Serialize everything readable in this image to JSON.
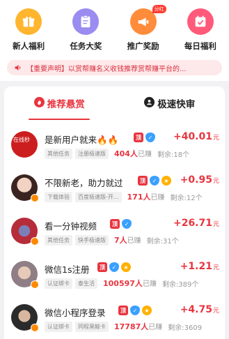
{
  "quick_actions": [
    {
      "label": "新人福利",
      "icon": "gift-icon",
      "color": "#ffb52e"
    },
    {
      "label": "任务大奖",
      "icon": "clipboard-icon",
      "color": "#9a8cf0"
    },
    {
      "label": "推广奖励",
      "icon": "megaphone-icon",
      "color": "#ff8c3a",
      "badge": "分红"
    },
    {
      "label": "每日福利",
      "icon": "calendar-check-icon",
      "color": "#ff5a7a"
    }
  ],
  "notice": {
    "text": "【重要声明】以赏帮赚名义收钱推荐赏帮赚平台的..."
  },
  "tabs": [
    {
      "label": "推荐悬赏",
      "active": true
    },
    {
      "label": "极速快审",
      "active": false
    }
  ],
  "tasks": [
    {
      "title": "是新用户就来🔥🔥",
      "tags": [
        "其他任务",
        "注册极速版"
      ],
      "earned_count": "404人",
      "earned_suffix": "已赚",
      "remaining": "剩余:18个",
      "reward": "+40.01",
      "unit": "元",
      "badges": [
        "顶",
        "shield"
      ],
      "avatar_color": "#cc1e1e",
      "avatar_text": "在线秒"
    },
    {
      "title": "不限新老，助力就过",
      "tags": [
        "下载体验",
        "百度极速版-开..."
      ],
      "earned_count": "171人",
      "earned_suffix": "已赚",
      "remaining": "剩余:12个",
      "reward": "+0.95",
      "unit": "元",
      "badges": [
        "顶",
        "shield",
        "gold"
      ],
      "avatar_color": "#d6a993",
      "avatar_text": ""
    },
    {
      "title": "看一分钟视频",
      "tags": [
        "其他任务",
        "快手极速版"
      ],
      "earned_count": "7人",
      "earned_suffix": "已赚",
      "remaining": "剩余:31个",
      "reward": "+26.71",
      "unit": "元",
      "badges": [
        "顶",
        "shield"
      ],
      "avatar_color": "#b62c3a",
      "avatar_text": ""
    },
    {
      "title": "微信1s注册",
      "tags": [
        "认证绑卡",
        "泰生活"
      ],
      "earned_count": "100597人",
      "earned_suffix": "已赚",
      "remaining": "剩余:389个",
      "reward": "+1.21",
      "unit": "元",
      "badges": [
        "顶",
        "shield",
        "gold"
      ],
      "avatar_color": "#8f7e86",
      "avatar_text": ""
    },
    {
      "title": "微信小程序登录",
      "tags": [
        "认证绑卡",
        "同程黑鲸卡"
      ],
      "earned_count": "17787人",
      "earned_suffix": "已赚",
      "remaining": "剩余:3609",
      "reward": "+4.75",
      "unit": "元",
      "badges": [
        "顶",
        "shield",
        "gold"
      ],
      "avatar_color": "#2b2b2b",
      "avatar_text": ""
    }
  ]
}
